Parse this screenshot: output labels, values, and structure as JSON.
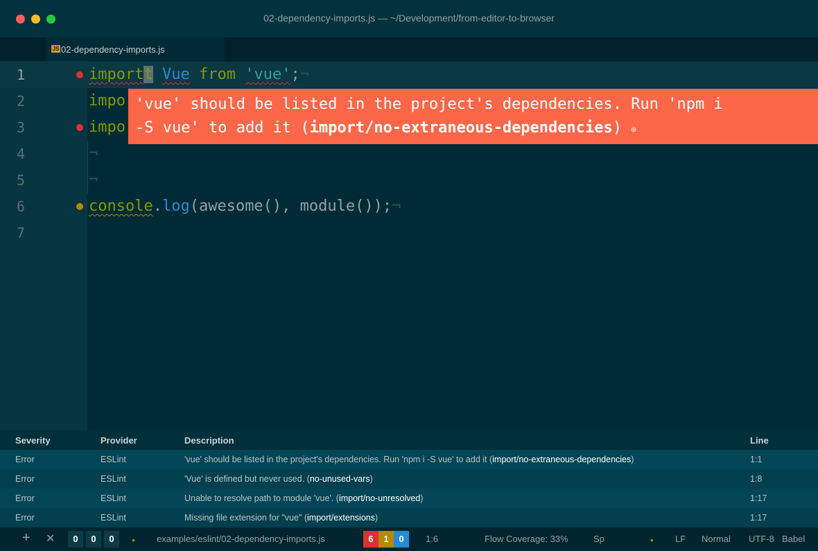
{
  "window": {
    "title": "02-dependency-imports.js — ~/Development/from-editor-to-browser"
  },
  "tab": {
    "icon": "JS",
    "label": "02-dependency-imports.js"
  },
  "editor": {
    "line_numbers": [
      "1",
      "2",
      "3",
      "4",
      "5",
      "6",
      "7"
    ],
    "line1": {
      "kw": "import",
      "cursor_char": "t",
      "id": "Vue",
      "from": "from",
      "str": "'vue'",
      "semi": ";",
      "eol": "¬"
    },
    "line2": {
      "text": "impo"
    },
    "line3": {
      "text": "impo"
    },
    "line4": {
      "eol": "¬"
    },
    "line5": {
      "eol": "¬"
    },
    "line6": {
      "obj": "console",
      "dot": ".",
      "fn": "log",
      "rest": "(awesome(), module());",
      "eol": "¬"
    }
  },
  "tooltip": {
    "line1": "'vue' should be listed in the project's dependencies. Run 'npm i",
    "line2_plain": "-S vue' to add it (",
    "rule": "import/no-extraneous-dependencies",
    "line2_close": ")",
    "link_icon": "link-icon"
  },
  "panel": {
    "headers": {
      "severity": "Severity",
      "provider": "Provider",
      "description": "Description",
      "line": "Line"
    },
    "rows": [
      {
        "severity": "Error",
        "provider": "ESLint",
        "desc": "'vue' should be listed in the project's dependencies. Run 'npm i -S vue' to add it (",
        "rule": "import/no-extraneous-dependencies",
        "close": ")",
        "line": "1:1"
      },
      {
        "severity": "Error",
        "provider": "ESLint",
        "desc": "'Vue' is defined but never used. (",
        "rule": "no-unused-vars",
        "close": ")",
        "line": "1:8"
      },
      {
        "severity": "Error",
        "provider": "ESLint",
        "desc": "Unable to resolve path to module 'vue'. (",
        "rule": "import/no-unresolved",
        "close": ")",
        "line": "1:17"
      },
      {
        "severity": "Error",
        "provider": "ESLint",
        "desc": "Missing file extension for \"vue\" (",
        "rule": "import/extensions",
        "close": ")",
        "line": "1:17"
      }
    ]
  },
  "statusbar": {
    "add": "+",
    "close": "✕",
    "counts_left": [
      "0",
      "0",
      "0"
    ],
    "path": "examples/eslint/02-dependency-imports.js",
    "lint_counts": [
      "6",
      "1",
      "0"
    ],
    "cursor_pos": "1:6",
    "flow": "Flow Coverage: 33%",
    "spaces": "Sp",
    "eol": "LF",
    "mode": "Normal",
    "encoding": "UTF-8",
    "grammar": "Babel"
  },
  "colors": {
    "background": "#002b36",
    "error": "#dc322f",
    "warning": "#b58900",
    "tooltip": "#fd6749"
  }
}
